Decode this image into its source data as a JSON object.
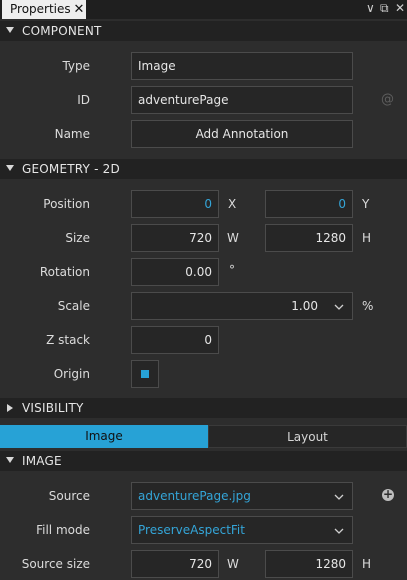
{
  "panel": {
    "tab_label": "Properties",
    "close_glyph": "✕",
    "menu_glyph": "∨",
    "float_glyph": "⧉",
    "pin_glyph": "✕"
  },
  "component": {
    "header": "COMPONENT",
    "type_label": "Type",
    "type_value": "Image",
    "id_label": "ID",
    "id_value": "adventurePage",
    "alias_glyph": "@",
    "name_label": "Name",
    "name_button": "Add Annotation"
  },
  "geometry": {
    "header": "GEOMETRY - 2D",
    "position_label": "Position",
    "position_x": "0",
    "position_x_unit": "X",
    "position_y": "0",
    "position_y_unit": "Y",
    "size_label": "Size",
    "size_w": "720",
    "size_w_unit": "W",
    "size_h": "1280",
    "size_h_unit": "H",
    "rotation_label": "Rotation",
    "rotation_value": "0.00",
    "rotation_unit": "°",
    "scale_label": "Scale",
    "scale_value": "1.00",
    "scale_unit": "%",
    "zstack_label": "Z stack",
    "zstack_value": "0",
    "origin_label": "Origin",
    "origin_color": "#27a2d6"
  },
  "visibility": {
    "header": "VISIBILITY"
  },
  "mode_tabs": {
    "image": "Image",
    "layout": "Layout"
  },
  "image": {
    "header": "IMAGE",
    "source_label": "Source",
    "source_value": "adventurePage.jpg",
    "add_glyph": "+",
    "fillmode_label": "Fill mode",
    "fillmode_value": "PreserveAspectFit",
    "sourcesize_label": "Source size",
    "sourcesize_w": "720",
    "sourcesize_w_unit": "W",
    "sourcesize_h": "1280",
    "sourcesize_h_unit": "H"
  }
}
